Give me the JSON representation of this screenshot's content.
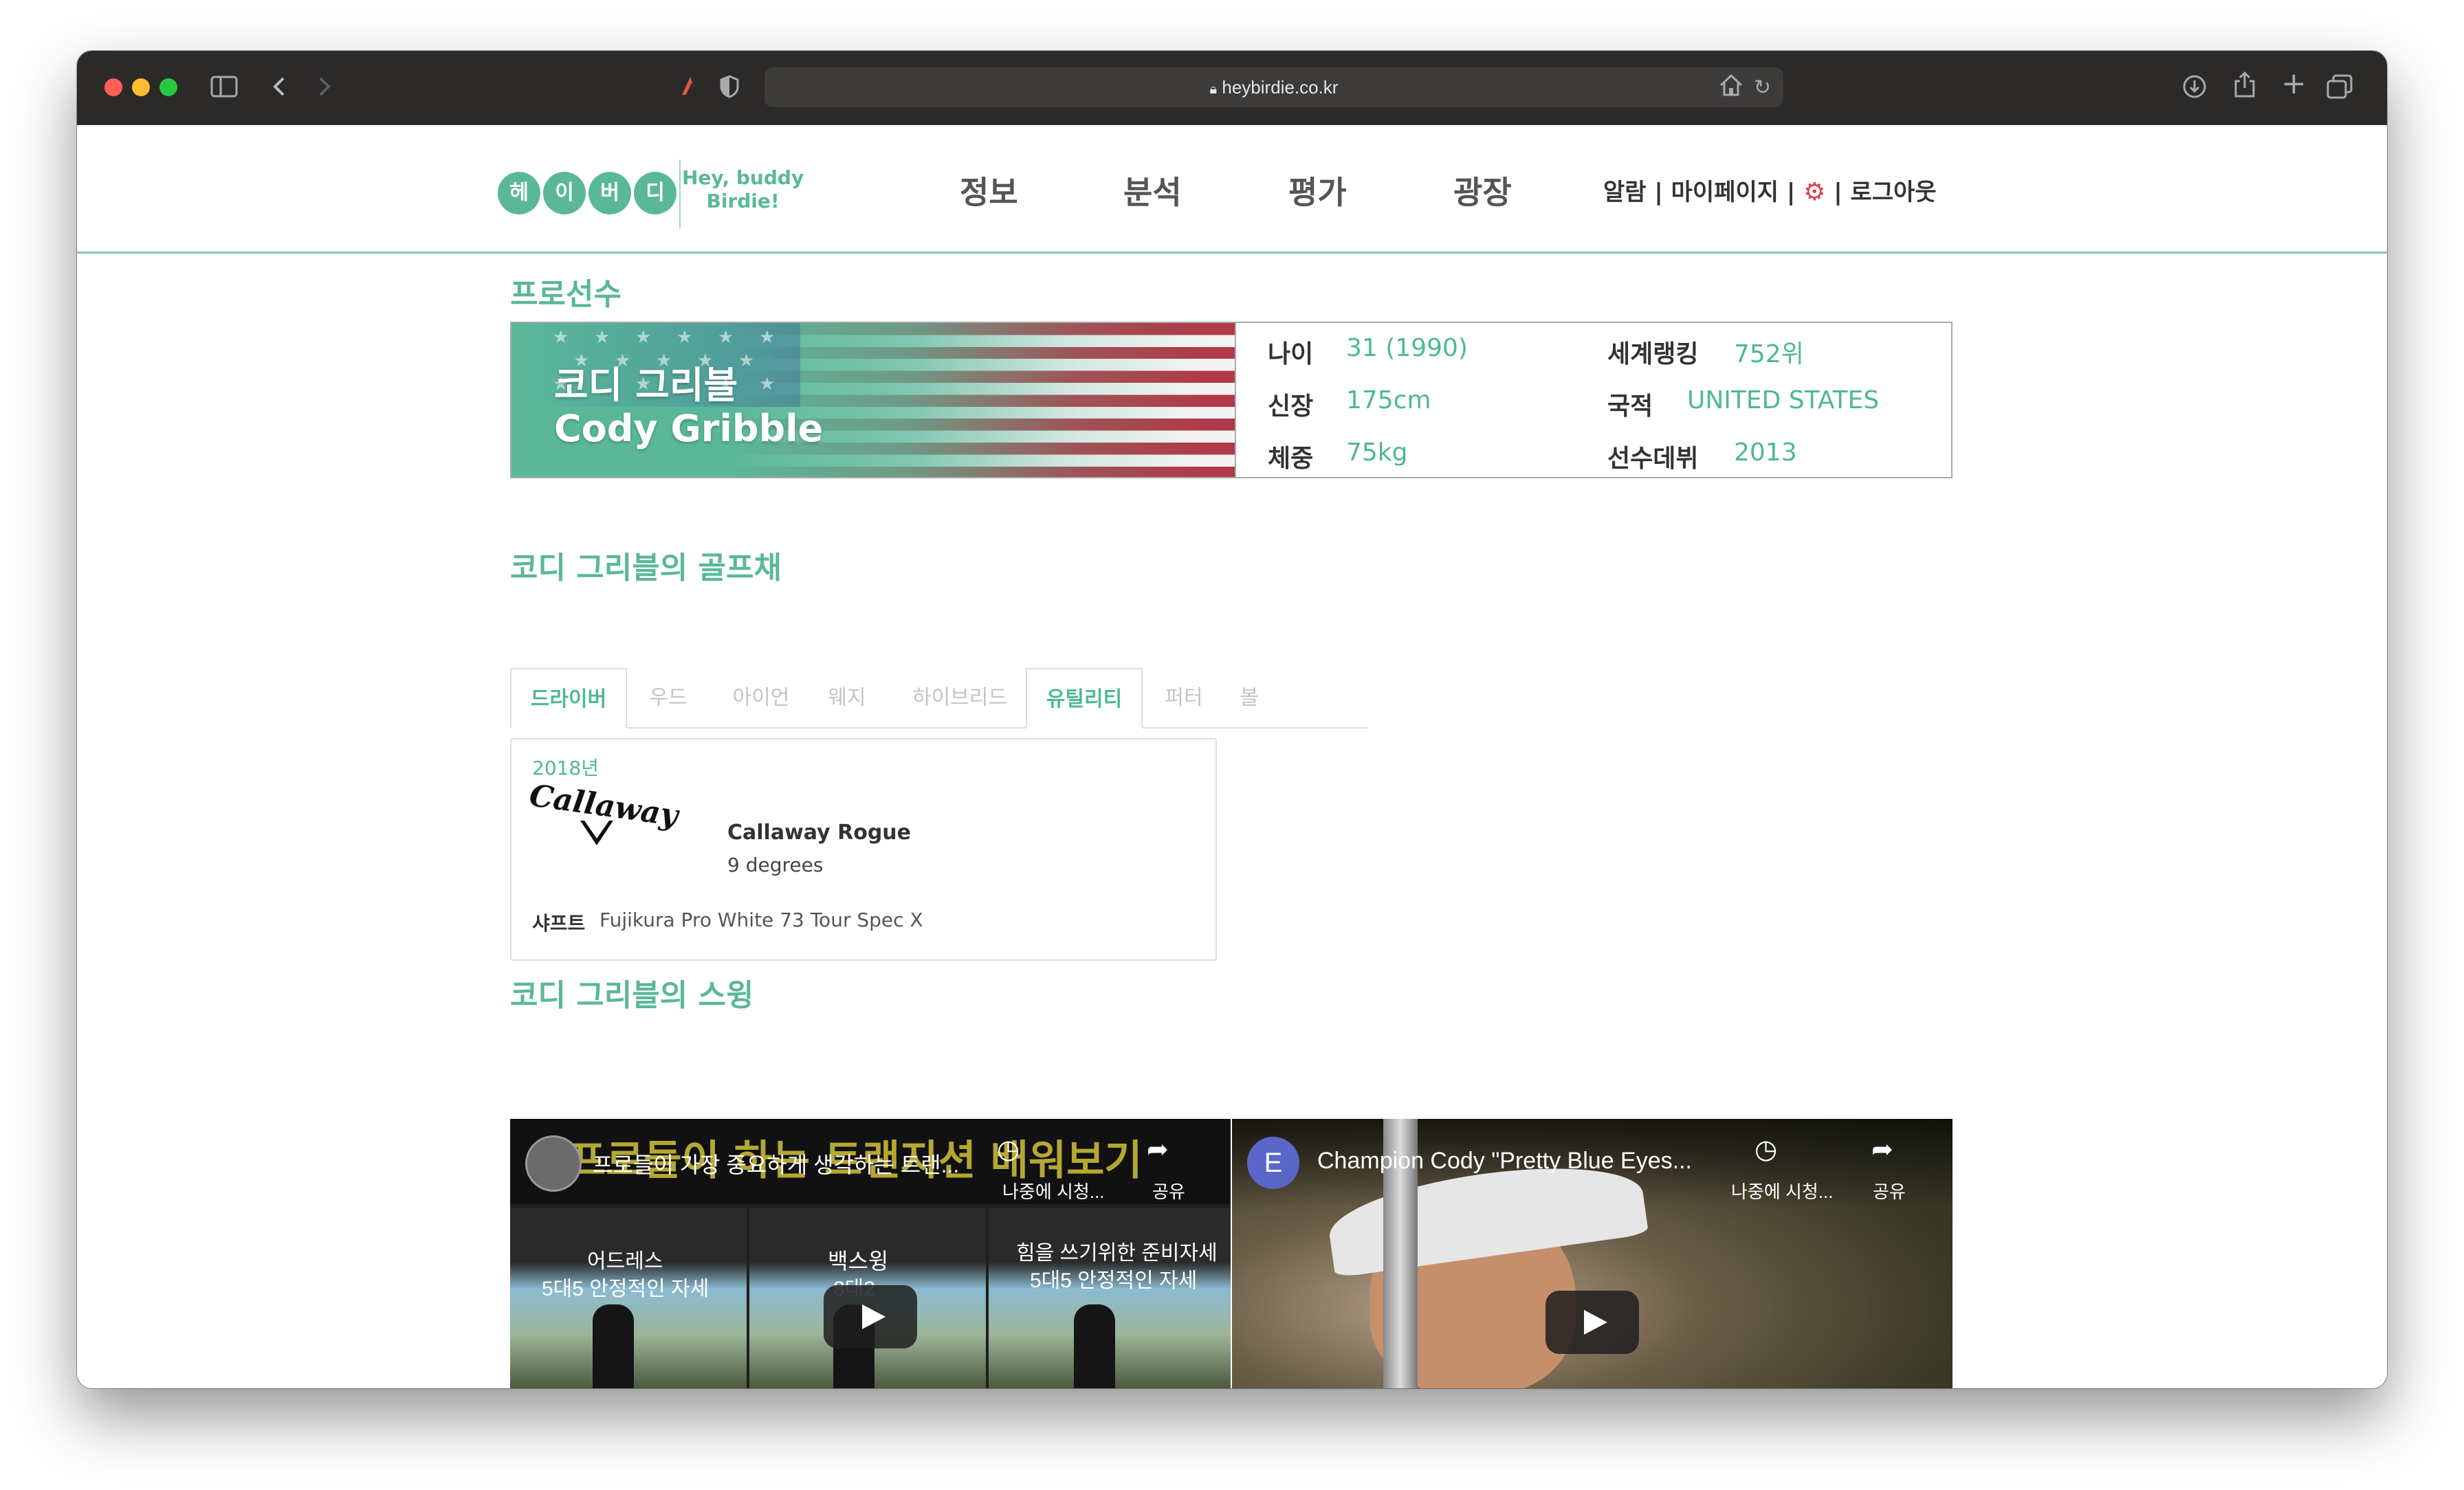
{
  "browser": {
    "url": "heybirdie.co.kr",
    "colors": {
      "close": "#ff5f57",
      "minimize": "#febc2e",
      "maximize": "#28c840"
    }
  },
  "site": {
    "logo_letters": [
      "헤",
      "이",
      "버",
      "디"
    ],
    "logo_tagline_1": "Hey, buddy",
    "logo_tagline_2": "Birdie!",
    "nav": [
      "정보",
      "분석",
      "평가",
      "광장"
    ],
    "user_links": "알람 | 마이페이지 |",
    "logout": "| 로그아웃",
    "accent_color": "#5ab899"
  },
  "player": {
    "section_title": "프로선수",
    "name_ko": "코디 그리블",
    "name_en": "Cody Gribble",
    "info": [
      {
        "label": "나이",
        "value": "31 (1990)"
      },
      {
        "label": "세계랭킹",
        "value": "752위"
      },
      {
        "label": "신장",
        "value": "175cm"
      },
      {
        "label": "국적",
        "value": "UNITED STATES"
      },
      {
        "label": "체중",
        "value": "75kg"
      },
      {
        "label": "선수데뷔",
        "value": "2013"
      }
    ]
  },
  "clubs": {
    "title": "코디 그리블의 골프채",
    "tabs": [
      "드라이버",
      "우드",
      "아이언",
      "웨지",
      "하이브리드",
      "유틸리티",
      "퍼터",
      "볼"
    ],
    "card": {
      "year": "2018년",
      "brand": "Callaway",
      "model": "Callaway Rogue",
      "loft": "9 degrees",
      "shaft_label": "샤프트",
      "shaft": "Fujikura Pro White 73 Tour Spec X"
    }
  },
  "swing": {
    "title": "코디 그리블의 스윙",
    "video1": {
      "banner": "프로들이 하는 트랜지션 배워보기",
      "title": "프로들이 가장 중요하게 생각하는 트랜...",
      "watch_later": "나중에 시청...",
      "share": "공유",
      "caption1_a": "어드레스",
      "caption1_b": "5대5 안정적인 자세",
      "caption2_a": "백스윙",
      "caption2_b": "8대2",
      "caption3_a": "힘을 쓰기위한 준비자세",
      "caption3_b": "5대5 안정적인 자세"
    },
    "video2": {
      "channel_initial": "E",
      "title": "Champion Cody \"Pretty Blue Eyes...",
      "watch_later": "나중에 시청...",
      "share": "공유"
    }
  }
}
